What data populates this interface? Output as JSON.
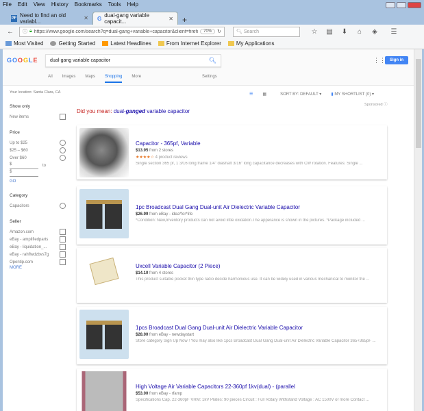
{
  "menu": [
    "File",
    "Edit",
    "View",
    "History",
    "Bookmarks",
    "Tools",
    "Help"
  ],
  "tabs": [
    {
      "label": "Need to find an old variabl...",
      "favicon": "PF"
    },
    {
      "label": "dual-gang variable capacit...",
      "favicon": "G"
    }
  ],
  "url": "https://www.google.com/search?q=dual-gang+variable+capacitor&client=firefox",
  "zoom": "70%",
  "browser_search_placeholder": "Search",
  "bookmarks": [
    "Most Visited",
    "Getting Started",
    "Latest Headlines",
    "From Internet Explorer",
    "My Applications"
  ],
  "google": {
    "logo": "GOOGLE",
    "query": "dual-gang variable capacitor",
    "sign_in": "Sign in",
    "tabs": [
      "All",
      "Images",
      "Maps",
      "Shopping",
      "More"
    ],
    "settings": "Settings"
  },
  "sidebar": {
    "location": "Your location: Santa Clara, CA",
    "show_only": "Show only",
    "new_items": "New items",
    "price": "Price",
    "price_options": [
      "Up to $25",
      "$25 – $60",
      "Over $60"
    ],
    "min": "$",
    "to": "to",
    "max": "$",
    "go": "GO",
    "category": "Category",
    "categories": [
      "Capacitors"
    ],
    "seller": "Seller",
    "sellers": [
      "Amazon.com",
      "eBay - amplifiedparts",
      "eBay - liquidation_...",
      "eBay - rahflwdzbvs7g",
      "Opentip.com"
    ],
    "more": "MORE"
  },
  "toolbar": {
    "sort": "SORT BY: DEFAULT ▾",
    "shortlist": "MY SHORTLIST (0) ▾",
    "sponsored": "Sponsored ⓘ"
  },
  "did_you_mean": {
    "label": "Did you mean:",
    "pre": "dual-",
    "bold": "ganged",
    "post": " variable capacitor"
  },
  "results": [
    {
      "title": "Capacitor - 365pf, Variable",
      "price": "$13.95",
      "source": "from 2 stores",
      "stars": "★★★★☆",
      "reviews": "4 product reviews",
      "desc": "Single section 365 pf, 1 3/16 long frame 1/4\" diashaft 3/16\" long capacitance decreases with CW rotation. Features: Single ..."
    },
    {
      "title": "1pc Broadcast Dual Gang Dual-unit Air Dielectric Variable Capacitor",
      "price": "$26.99",
      "source": "from eBay - idea*for*life",
      "desc": "*Condition: New,Inventory products can not avoid little oxidation.The apperance is shown in the pictures. *Package included ..."
    },
    {
      "title": "Uxcell Variable Capacitor (2 Piece)",
      "price": "$14.10",
      "source": "from 4 stores",
      "desc": "This product suitable pocket thin type radio decide harmonious use. It can be widely used in various mechanical to monitor the ..."
    },
    {
      "title": "1pcs Broadcast Dual Gang Dual-unit Air Dielectric Variable Capacitor",
      "price": "$28.00",
      "source": "from eBay - newdaystart",
      "desc": "Store category Sign Up Now ! You may also like 1pcs Broadcast Dual Gang Dual-unit Air Dielectric Variable Capacitor 365+365pF ..."
    },
    {
      "title": "High Voltage Air Variable Capacitors 22-360pf 1kv(dual) - (parallel",
      "price": "$53.00",
      "source": "from eBay - rfamp",
      "desc": "Specifications Cap. 22-360pF VRM: 1kV Plates: 90 pieces Circuit : Full Rotary Withstand Voltage : AC 1500V or more Contact ..."
    }
  ]
}
